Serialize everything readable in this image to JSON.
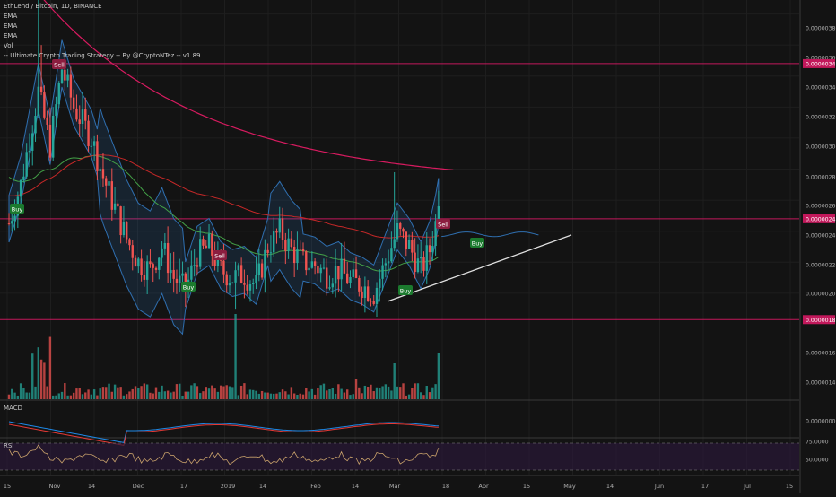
{
  "legend": {
    "title": "EthLend / Bitcoin, 1D, BINANCE",
    "line1": "EMA",
    "line2": "EMA",
    "line3": "EMA",
    "line4": "Vol",
    "line5": "-- Ultimate Crypto Trading Strategy -- By @CryptoNTez -- v1.89"
  },
  "panels": {
    "macd_label": "MACD",
    "rsi_label": "RSI"
  },
  "colors": {
    "background": "#131313",
    "up": "#26a69a",
    "down": "#ef5350",
    "ema_long": "#d81b60",
    "ema_mid": "#c62828",
    "ema_short": "#43a047",
    "cloud": "#2f6fb0",
    "hline": "#c2185b",
    "trendline": "#e0e0e0",
    "rsi_line": "#c9a26b",
    "rsi_band": "#2a1838",
    "macd_line": "#1e88e5",
    "signal_line": "#e53935"
  },
  "chart_data": {
    "type": "candlestick",
    "title": "EthLend / Bitcoin, 1D, BINANCE",
    "x_ticks": [
      "15",
      "Nov",
      "14",
      "Dec",
      "17",
      "2019",
      "14",
      "Feb",
      "14",
      "Mar",
      "18",
      "Apr",
      "15",
      "May",
      "14",
      "Jun",
      "17",
      "Jul",
      "15"
    ],
    "y_ticks": [
      "0.00000380",
      "0.00000360",
      "0.00000340",
      "0.00000320",
      "0.00000300",
      "0.00000280",
      "0.00000260",
      "0.00000240",
      "0.00000220",
      "0.00000200",
      "0.00000160",
      "0.00000140",
      "0.00000000",
      "75.0000",
      "50.0000"
    ],
    "ylim": [
      1.82e-06,
      3.89e-06
    ],
    "price_levels": [
      {
        "label": "0.00000348",
        "value": 3.48e-06
      },
      {
        "label": "0.00000248",
        "value": 2.48e-06
      },
      {
        "label": "0.00000183",
        "value": 1.83e-06
      }
    ],
    "signals": [
      {
        "label": "Sell",
        "date": "Oct 30 2018"
      },
      {
        "label": "Buy",
        "date": "Oct 18 2018"
      },
      {
        "label": "Sell",
        "date": "Dec 25 2018"
      },
      {
        "label": "Buy",
        "date": "Dec 20 2018"
      },
      {
        "label": "Sell",
        "date": "Mar 18 2019"
      },
      {
        "label": "Buy",
        "date": "Mar 28 2019"
      },
      {
        "label": "Buy",
        "date": "Mar 4 2019"
      }
    ],
    "candles_summary": {
      "first_date": "Oct 15 2018",
      "last_date": "Mar 28 2019",
      "last_close": 2.56e-06,
      "period_high": 3.8e-06,
      "period_low": 1.85e-06
    }
  }
}
